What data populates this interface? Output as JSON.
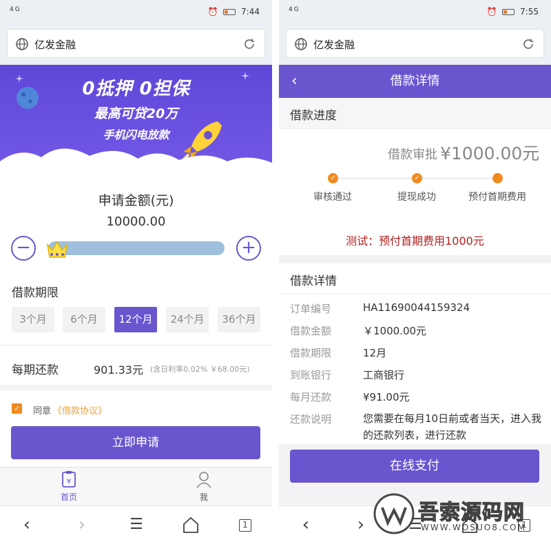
{
  "left": {
    "status": {
      "signal": "4G",
      "time": "7:44"
    },
    "address": {
      "title": "亿发金融"
    },
    "banner": {
      "line1": "0抵押 0担保",
      "line2": "最高可贷20万",
      "line3": "手机闪电放款"
    },
    "apply_amount_label": "申请金额(元)",
    "apply_amount_value": "10000.00",
    "minus": "−",
    "plus": "+",
    "term_label": "借款期限",
    "terms": [
      "3个月",
      "6个月",
      "12个月",
      "24个月",
      "36个月"
    ],
    "selected_term_index": 2,
    "repay_label": "每期还款",
    "repay_value": "901.33元",
    "repay_note": "(含日利率0.02% ￥68.00元)",
    "agree_text": "同意",
    "agreement_link": "《借款协议》",
    "submit": "立即申请",
    "tabs": [
      {
        "label": "首页",
        "icon": "home-icon"
      },
      {
        "label": "我",
        "icon": "user-icon"
      }
    ],
    "colors": {
      "primary": "#6a55cf",
      "accent": "#f08a1e"
    }
  },
  "right": {
    "status": {
      "signal": "4G",
      "time": "7:55"
    },
    "address": {
      "title": "亿发金融"
    },
    "header": {
      "title": "借款详情",
      "back": "‹"
    },
    "progress_title": "借款进度",
    "approval_text": "借款审批",
    "approval_amount": "¥1000.00元",
    "steps": [
      "审核通过",
      "提现成功",
      "预付首期费用"
    ],
    "test_notice": "测试：预付首期费用1000元",
    "detail_title": "借款详情",
    "details": [
      {
        "label": "订单编号",
        "value": "HA11690044159324"
      },
      {
        "label": "借款金额",
        "value": "￥1000.00元"
      },
      {
        "label": "借款期限",
        "value": "12月"
      },
      {
        "label": "到账银行",
        "value": "工商银行"
      },
      {
        "label": "每月还款",
        "value": "¥91.00元"
      },
      {
        "label": "还款说明",
        "value": "您需要在每月10日前或者当天，进入我的还款列表，进行还款"
      }
    ],
    "pay_button": "在线支付"
  },
  "watermark": {
    "text": "吾索源码网",
    "url": "WWW.WOSUO8.COM"
  },
  "browser_tab_count": "1"
}
